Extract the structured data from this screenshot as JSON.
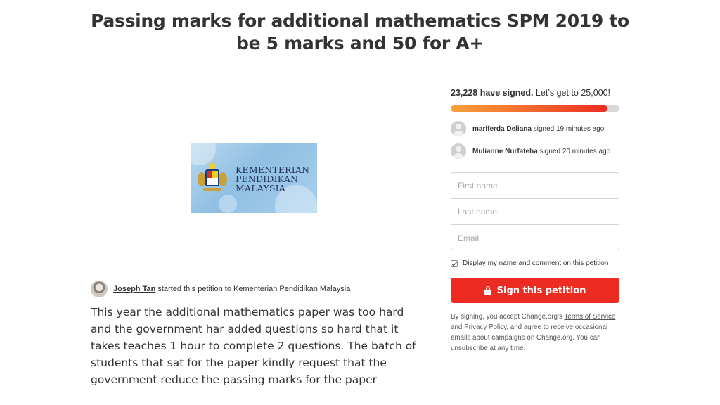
{
  "petition": {
    "title": "Passing marks for additional mathematics SPM 2019 to be 5 marks and 50 for A+",
    "image_logo_text": [
      "KEMENTERIAN",
      "PENDIDIKAN",
      "MALAYSIA"
    ],
    "starter_name": "Joseph Tan",
    "starter_suffix": "started this petition to Kementerian Pendidikan Malaysia",
    "body": "This year the additional mathematics paper was too hard and the government har added questions so hard that it takes teaches 1 hour to complete  2 questions. The batch of students that sat for the paper kindly request that the government reduce the passing marks for the paper"
  },
  "signatures": {
    "count_text": "23,228 have signed.",
    "goal_text": "Let’s get to 25,000!",
    "progress_fraction": 0.929,
    "recent": [
      {
        "name": "marlferda Deliana",
        "time": "signed 19 minutes ago"
      },
      {
        "name": "Mulianne Nurfateha",
        "time": "signed 20 minutes ago"
      }
    ]
  },
  "form": {
    "first_name_placeholder": "First name",
    "last_name_placeholder": "Last name",
    "email_placeholder": "Email",
    "display_checkbox_label": "Display my name and comment on this petition",
    "display_checked": true,
    "sign_button_label": "Sign this petition"
  },
  "legal": {
    "prefix": "By signing, you accept Change.org’s",
    "terms_link": "Terms of Service",
    "and": "and",
    "privacy_link": "Privacy Policy",
    "suffix": ", and agree to receive occasional emails about campaigns on Change.org. You can unsubscribe at any time."
  },
  "colors": {
    "accent": "#ec2c22",
    "progress_start": "#f7a23b",
    "progress_end": "#ec2c22"
  }
}
